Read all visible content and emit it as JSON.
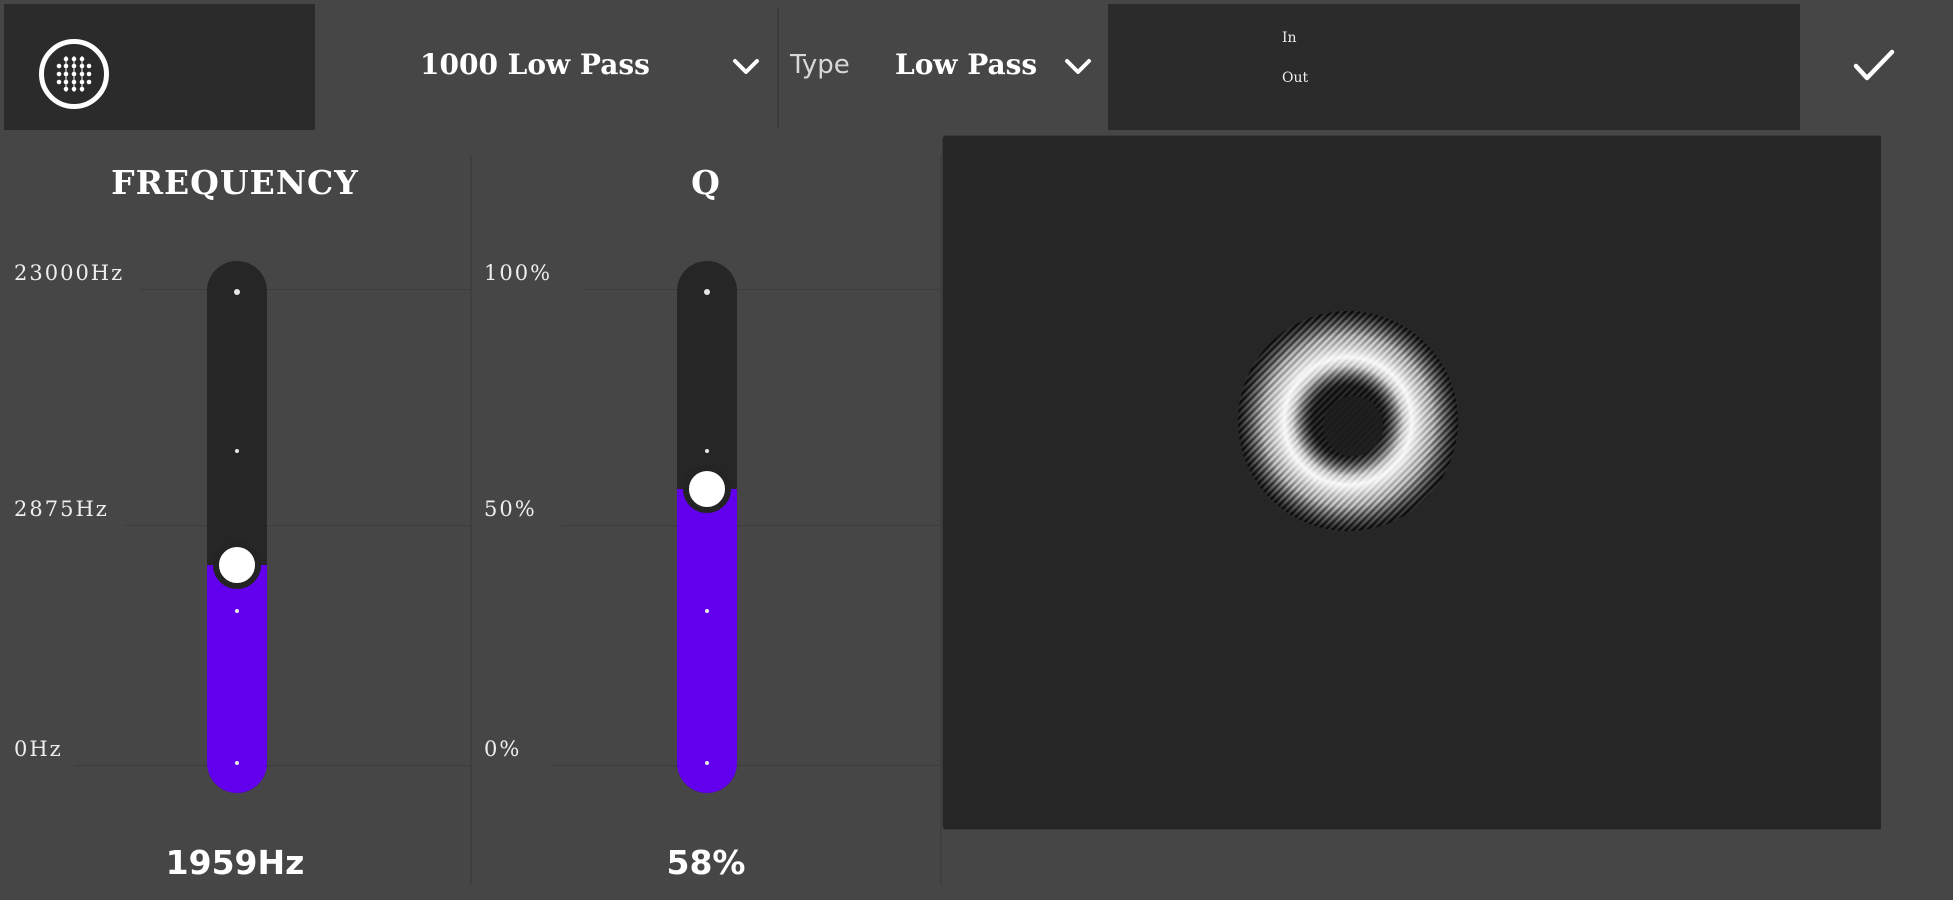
{
  "header": {
    "logo_icon": "grid-circle-logo-icon",
    "preset": "1000 Low Pass",
    "type_label": "Type",
    "type_value": "Low Pass",
    "meter_in_label": "In",
    "meter_out_label": "Out",
    "confirm_icon": "checkmark-icon"
  },
  "frequency": {
    "title": "FREQUENCY",
    "ticks": [
      "23000Hz",
      "2875Hz",
      "0Hz"
    ],
    "value_label": "1959Hz",
    "level": 0.42
  },
  "q": {
    "title": "Q",
    "ticks": [
      "100%",
      "50%",
      "0%"
    ],
    "value_label": "58%",
    "level": 0.58
  },
  "colors": {
    "accent": "#6200ee",
    "background": "#464646",
    "panel_dark": "#262626"
  }
}
